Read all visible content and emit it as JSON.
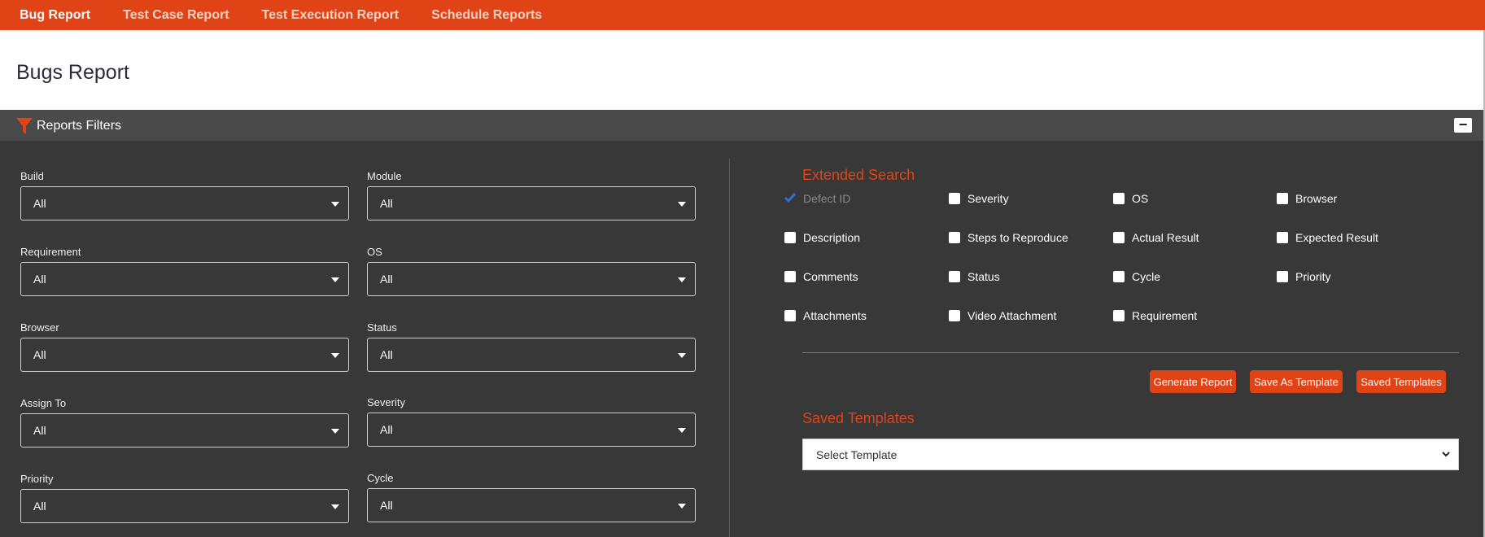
{
  "nav": {
    "tabs": [
      {
        "label": "Bug Report",
        "active": true
      },
      {
        "label": "Test Case Report",
        "active": false
      },
      {
        "label": "Test Execution Report",
        "active": false
      },
      {
        "label": "Schedule Reports",
        "active": false
      }
    ]
  },
  "page": {
    "title": "Bugs Report"
  },
  "filters_bar": {
    "title": "Reports Filters",
    "collapse_label": "−"
  },
  "filters": [
    {
      "label": "Build",
      "value": "All"
    },
    {
      "label": "Module",
      "value": "All"
    },
    {
      "label": "Requirement",
      "value": "All"
    },
    {
      "label": "OS",
      "value": "All"
    },
    {
      "label": "Browser",
      "value": "All"
    },
    {
      "label": "Status",
      "value": "All"
    },
    {
      "label": "Assign To",
      "value": "All"
    },
    {
      "label": "Severity",
      "value": "All"
    },
    {
      "label": "Priority",
      "value": "All"
    },
    {
      "label": "Cycle",
      "value": "All"
    }
  ],
  "extended_search": {
    "title": "Extended Search",
    "options": [
      {
        "label": "Defect ID",
        "checked": true,
        "disabled": true
      },
      {
        "label": "Severity",
        "checked": false
      },
      {
        "label": "OS",
        "checked": false
      },
      {
        "label": "Browser",
        "checked": false
      },
      {
        "label": "Description",
        "checked": false
      },
      {
        "label": "Steps to Reproduce",
        "checked": false
      },
      {
        "label": "Actual Result",
        "checked": false
      },
      {
        "label": "Expected Result",
        "checked": false
      },
      {
        "label": "Comments",
        "checked": false
      },
      {
        "label": "Status",
        "checked": false
      },
      {
        "label": "Cycle",
        "checked": false
      },
      {
        "label": "Priority",
        "checked": false
      },
      {
        "label": "Attachments",
        "checked": false
      },
      {
        "label": "Video Attachment",
        "checked": false
      },
      {
        "label": "Requirement",
        "checked": false
      }
    ]
  },
  "actions": {
    "generate": "Generate Report",
    "save_as_template": "Save As Template",
    "saved_templates": "Saved Templates"
  },
  "saved_templates": {
    "title": "Saved Templates",
    "select_value": "Select Template"
  },
  "colors": {
    "accent": "#e04316",
    "panel": "#383838",
    "bar": "#4a4a4a"
  }
}
